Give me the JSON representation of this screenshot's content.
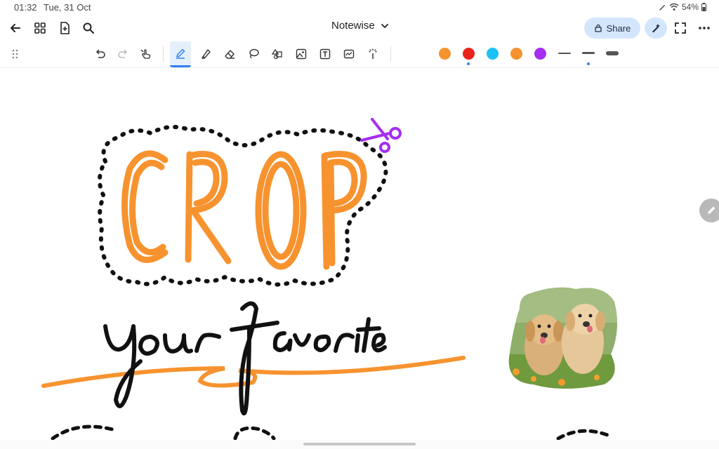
{
  "status": {
    "time": "01:32",
    "date": "Tue, 31 Oct",
    "battery": "54%"
  },
  "topbar": {
    "title": "Notewise",
    "share_label": "Share"
  },
  "toolbar": {
    "tools": [
      "undo",
      "redo",
      "touch-draw",
      "pen",
      "highlighter",
      "eraser",
      "lasso",
      "shapes",
      "image",
      "text",
      "sticker",
      "laser"
    ],
    "active_tool": "pen",
    "colors": [
      "#f7932f",
      "#e8231b",
      "#1dc2f5",
      "#f7932f",
      "#a42ef1"
    ],
    "selected_color_index": 1,
    "selected_stroke_index": 1
  },
  "canvas": {
    "heading_word": "CROP",
    "script_words": "your favorite",
    "accent_color": "#f7932f",
    "scissor_color": "#a42ef1"
  }
}
